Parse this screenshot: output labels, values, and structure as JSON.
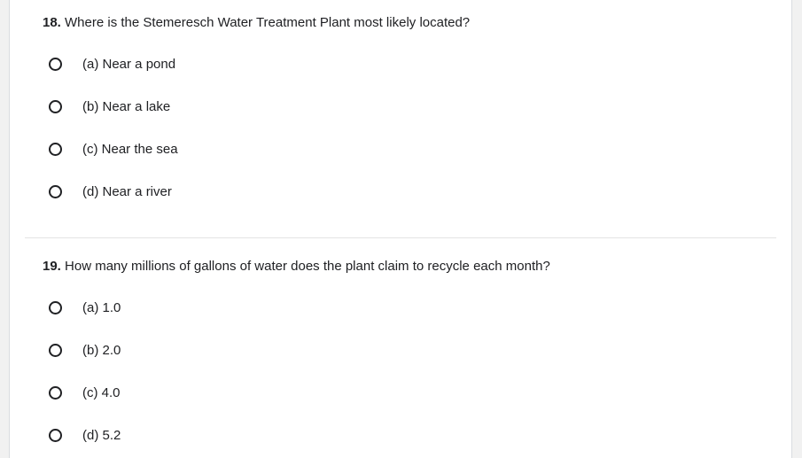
{
  "questions": [
    {
      "number": "18.",
      "text": " Where is the Stemeresch Water Treatment Plant most likely located?",
      "options": [
        "(a) Near a pond",
        "(b) Near a lake",
        "(c) Near the sea",
        "(d) Near a river"
      ]
    },
    {
      "number": "19.",
      "text": " How many millions of gallons of water does the plant claim to recycle each month?",
      "options": [
        "(a) 1.0",
        "(b) 2.0",
        "(c) 4.0",
        "(d) 5.2"
      ]
    }
  ]
}
